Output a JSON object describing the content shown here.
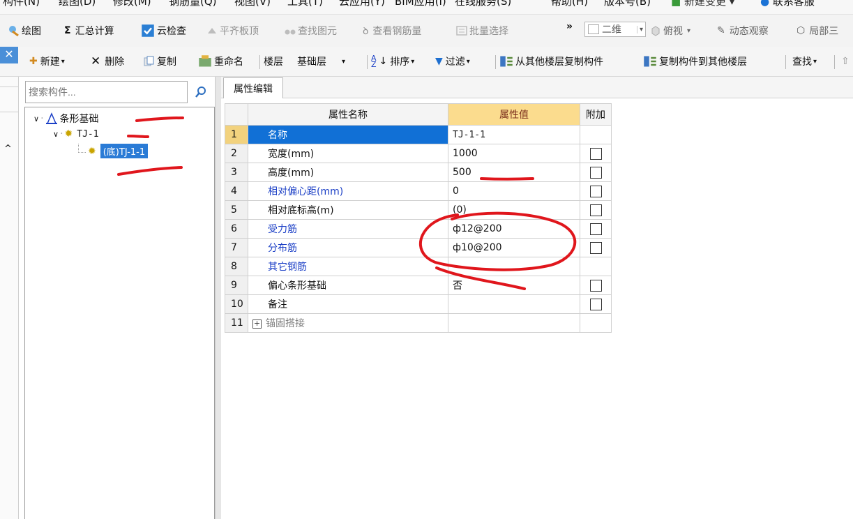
{
  "menu": [
    "构件(N)",
    "绘图(D)",
    "修改(M)",
    "钢筋量(Q)",
    "视图(V)",
    "工具(T)",
    "云应用(Y)",
    "BIM应用(I)",
    "在线服务(S)",
    "帮助(H)",
    "版本号(B)",
    "新建变更",
    "联系客服"
  ],
  "toolbar1": {
    "draw": "绘图",
    "sum": "汇总计算",
    "cloud_check": "云检查",
    "flat_slab": "平齐板顶",
    "find_element": "查找图元",
    "view_rebar": "查看钢筋量",
    "batch_select": "批量选择",
    "more": "»",
    "view2d": "二维",
    "top_view": "俯视",
    "dynamic_view": "动态观察",
    "local_3d": "局部三"
  },
  "toolbar2": {
    "new": "新建",
    "delete": "删除",
    "copy": "复制",
    "rename": "重命名",
    "floor_label": "楼层",
    "floor_value": "基础层",
    "sort": "排序",
    "filter": "过滤",
    "copy_from_floor": "从其他楼层复制构件",
    "copy_to_floor": "复制构件到其他楼层",
    "find": "查找"
  },
  "search": {
    "placeholder": "搜索构件..."
  },
  "tree": {
    "root": "条形基础",
    "child": "TJ-1",
    "leaf": "(底)TJ-1-1"
  },
  "tab": "属性编辑",
  "table": {
    "headers": [
      "属性名称",
      "属性值",
      "附加"
    ],
    "rows": [
      {
        "num": "1",
        "name": "名称",
        "value": "TJ-1-1",
        "checkbox": false
      },
      {
        "num": "2",
        "name": "宽度(mm)",
        "value": "1000",
        "checkbox": true
      },
      {
        "num": "3",
        "name": "高度(mm)",
        "value": "500",
        "checkbox": true
      },
      {
        "num": "4",
        "name": "相对偏心距(mm)",
        "value": "0",
        "checkbox": true
      },
      {
        "num": "5",
        "name": "相对底标高(m)",
        "value": "(0)",
        "checkbox": true
      },
      {
        "num": "6",
        "name": "受力筋",
        "value": "ф12@200",
        "checkbox": true
      },
      {
        "num": "7",
        "name": "分布筋",
        "value": "ф10@200",
        "checkbox": true
      },
      {
        "num": "8",
        "name": "其它钢筋",
        "value": "",
        "checkbox": false
      },
      {
        "num": "9",
        "name": "偏心条形基础",
        "value": "否",
        "checkbox": true
      },
      {
        "num": "10",
        "name": "备注",
        "value": "",
        "checkbox": true
      },
      {
        "num": "11",
        "name": "锚固搭接",
        "value": "",
        "checkbox": false
      }
    ]
  },
  "colors": {
    "accent": "#1170d6",
    "annotation": "#e0161c",
    "header_highlight": "#fbdc8e"
  }
}
